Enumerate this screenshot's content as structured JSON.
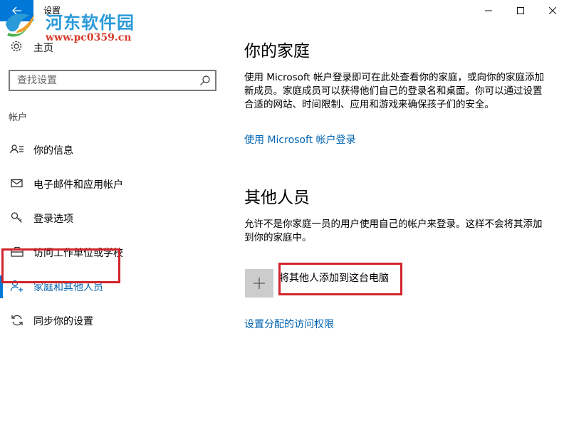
{
  "window": {
    "title": "设置",
    "back_icon": "arrow-left-icon",
    "minimize_icon": "minimize-icon",
    "maximize_icon": "maximize-icon",
    "close_icon": "close-icon",
    "accent_color": "#0078d7"
  },
  "watermark": {
    "name": "河东软件园",
    "url": "www.pc0359.cn"
  },
  "sidebar": {
    "home_label": "主页",
    "search_placeholder": "查找设置",
    "search_value": "",
    "section_header": "帐户",
    "items": [
      {
        "label": "你的信息",
        "icon": "person-info-icon",
        "active": false
      },
      {
        "label": "电子邮件和应用帐户",
        "icon": "mail-icon",
        "active": false
      },
      {
        "label": "登录选项",
        "icon": "key-icon",
        "active": false
      },
      {
        "label": "访问工作单位或学校",
        "icon": "briefcase-icon",
        "active": false
      },
      {
        "label": "家庭和其他人员",
        "icon": "person-add-icon",
        "active": true
      },
      {
        "label": "同步你的设置",
        "icon": "sync-icon",
        "active": false
      }
    ]
  },
  "main": {
    "family": {
      "title": "你的家庭",
      "description": "使用 Microsoft 帐户登录即可在此处查看你的家庭，或向你的家庭添加新成员。家庭成员可以获得他们自己的登录名和桌面。你可以通过设置合适的网站、时间限制、应用和游戏来确保孩子们的安全。",
      "link": "使用 Microsoft 帐户登录"
    },
    "others": {
      "title": "其他人员",
      "description": "允许不是你家庭一员的用户使用自己的帐户来登录。这样不会将其添加到你的家庭中。",
      "add_label": "将其他人添加到这台电脑",
      "link": "设置分配的访问权限"
    }
  },
  "annotation_color": "#d1232a",
  "link_color": "#0063b1"
}
